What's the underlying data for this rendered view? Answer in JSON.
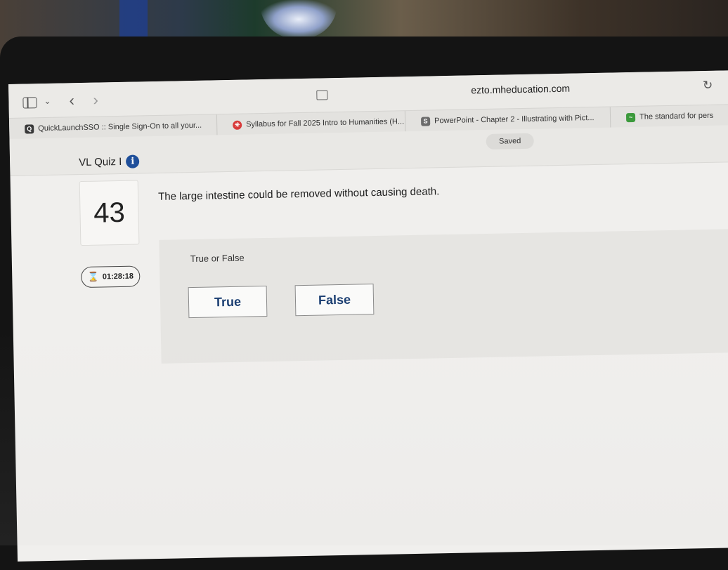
{
  "browser": {
    "url": "ezto.mheducation.com"
  },
  "bookmarks": [
    {
      "label": "QuickLaunchSSO :: Single Sign-On to all your...",
      "color": "#3a3a3a",
      "glyph": "Q"
    },
    {
      "label": "Syllabus for Fall 2025 Intro to Humanities (H...",
      "color": "#d83a3a",
      "glyph": "✳"
    },
    {
      "label": "PowerPoint - Chapter 2 - Illustrating with Pict...",
      "color": "#6c6c6c",
      "glyph": "S"
    },
    {
      "label": "The standard for pers",
      "color": "#3c9a3c",
      "glyph": "~"
    }
  ],
  "status": {
    "saved": "Saved"
  },
  "quiz": {
    "title": "VL Quiz I",
    "question_number": "43",
    "question_text": "The large intestine could be removed without causing death.",
    "question_type": "True or False",
    "timer": "01:28:18",
    "options": [
      "True",
      "False"
    ]
  },
  "colors": {
    "option_text": "#1c3f72",
    "info_icon": "#1f4f9a"
  }
}
